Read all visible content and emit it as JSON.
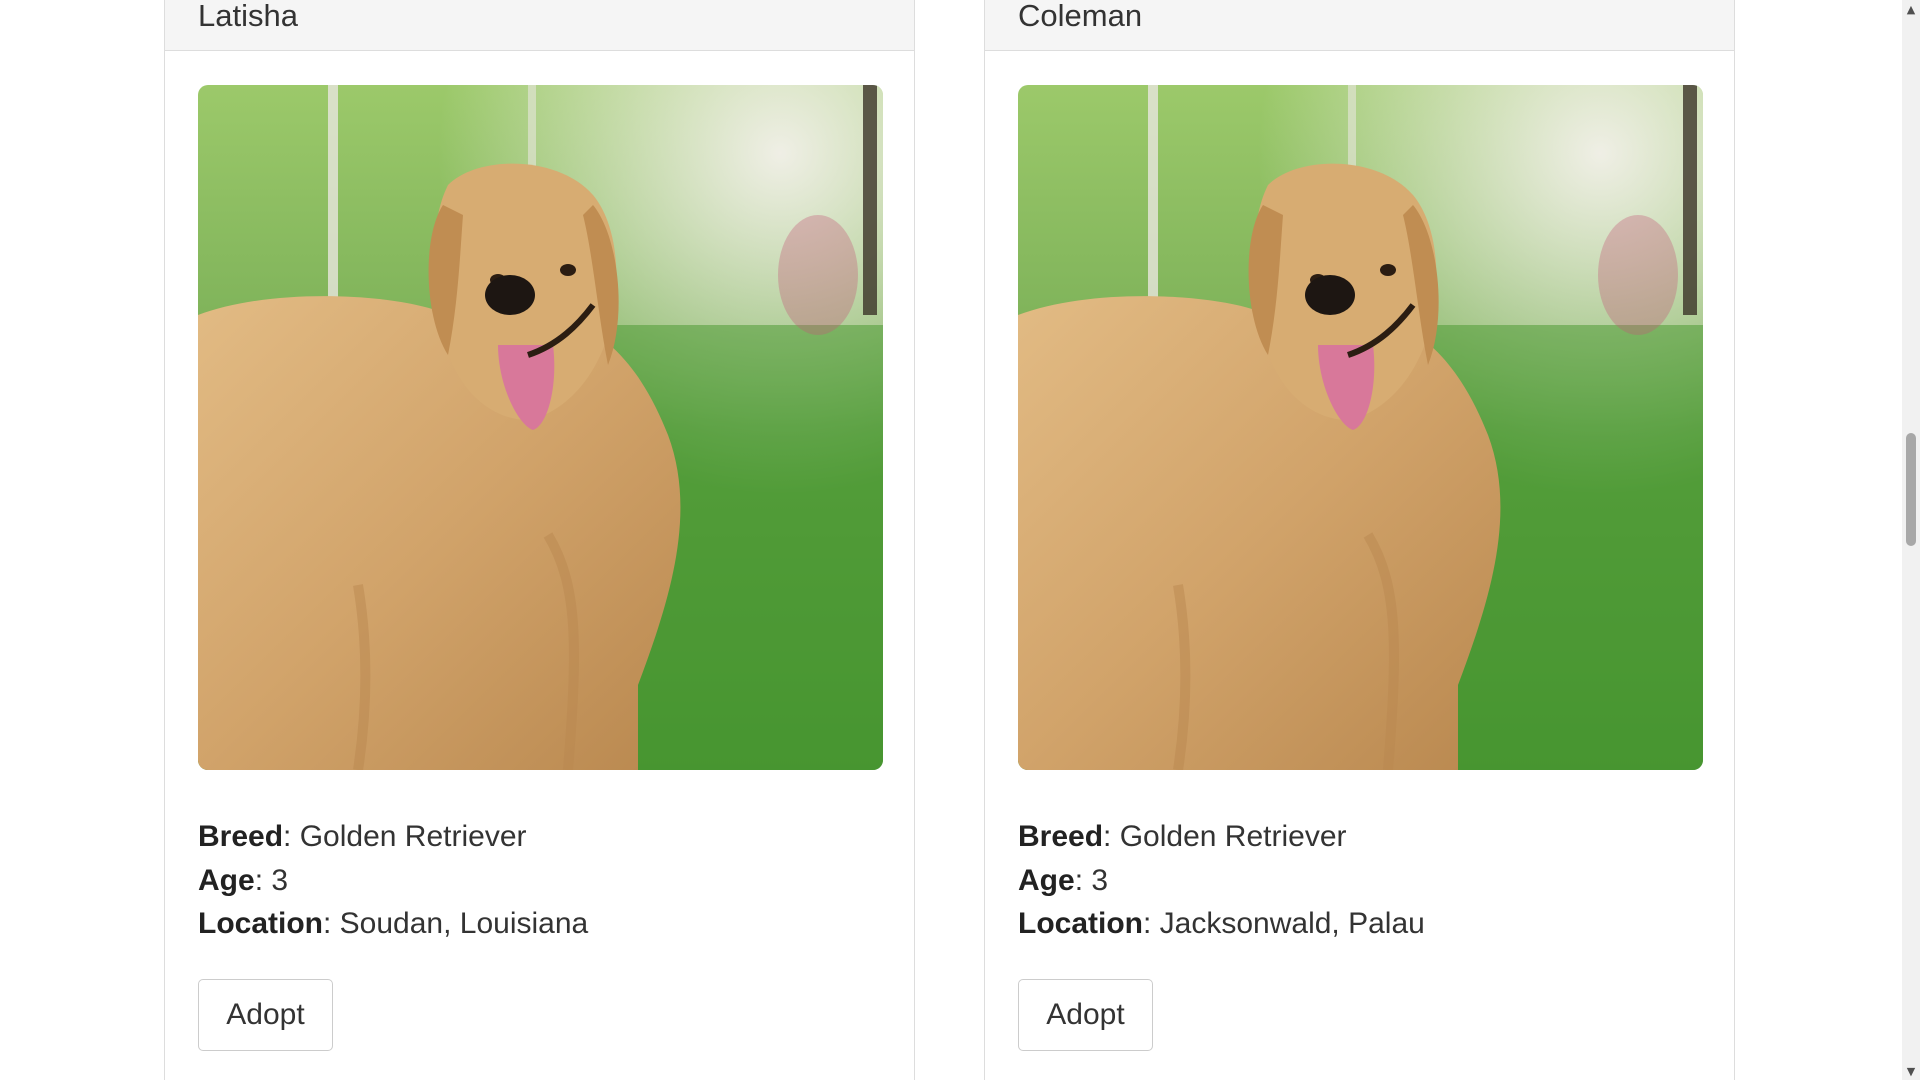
{
  "pets": [
    {
      "name": "Latisha",
      "breed_label": "Breed",
      "breed": ": Golden Retriever",
      "age_label": "Age",
      "age": ": 3",
      "location_label": "Location",
      "location": ": Soudan, Louisiana",
      "adopt_label": "Adopt"
    },
    {
      "name": "Coleman",
      "breed_label": "Breed",
      "breed": ": Golden Retriever",
      "age_label": "Age",
      "age": ": 3",
      "location_label": "Location",
      "location": ": Jacksonwald, Palau",
      "adopt_label": "Adopt"
    }
  ],
  "scrollbar": {
    "up_icon": "▲",
    "down_icon": "▼"
  }
}
